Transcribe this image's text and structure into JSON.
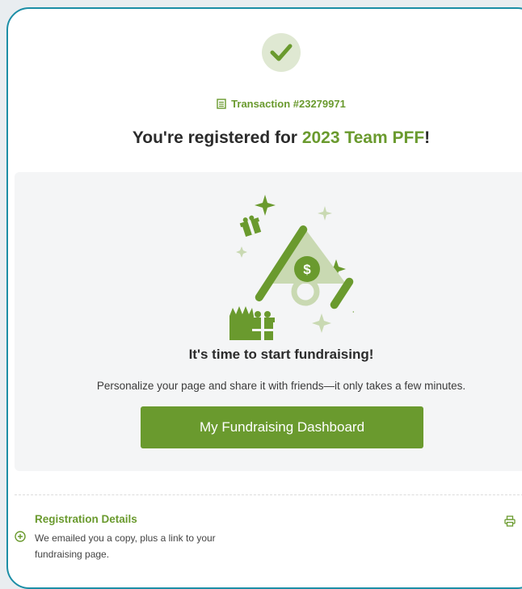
{
  "header": {
    "transaction_label": "Transaction #23279971",
    "headline_prefix": "You're registered for ",
    "headline_event": "2023 Team PFF",
    "headline_suffix": "!"
  },
  "promo": {
    "title": "It's time to start fundraising!",
    "description": "Personalize your page and share it with friends—it only takes a few minutes.",
    "button_label": "My Fundraising Dashboard"
  },
  "registration": {
    "title": "Registration Details",
    "description": "We emailed you a copy, plus a link to your fundraising page."
  },
  "icons": {
    "success": "check-icon",
    "transaction": "document-icon",
    "expand": "plus-circle-icon",
    "print": "printer-icon"
  },
  "colors": {
    "accent": "#6a9a2e",
    "border": "#1c8ea6",
    "panel_bg": "#f4f5f6",
    "check_bg": "#dfe8d2"
  }
}
